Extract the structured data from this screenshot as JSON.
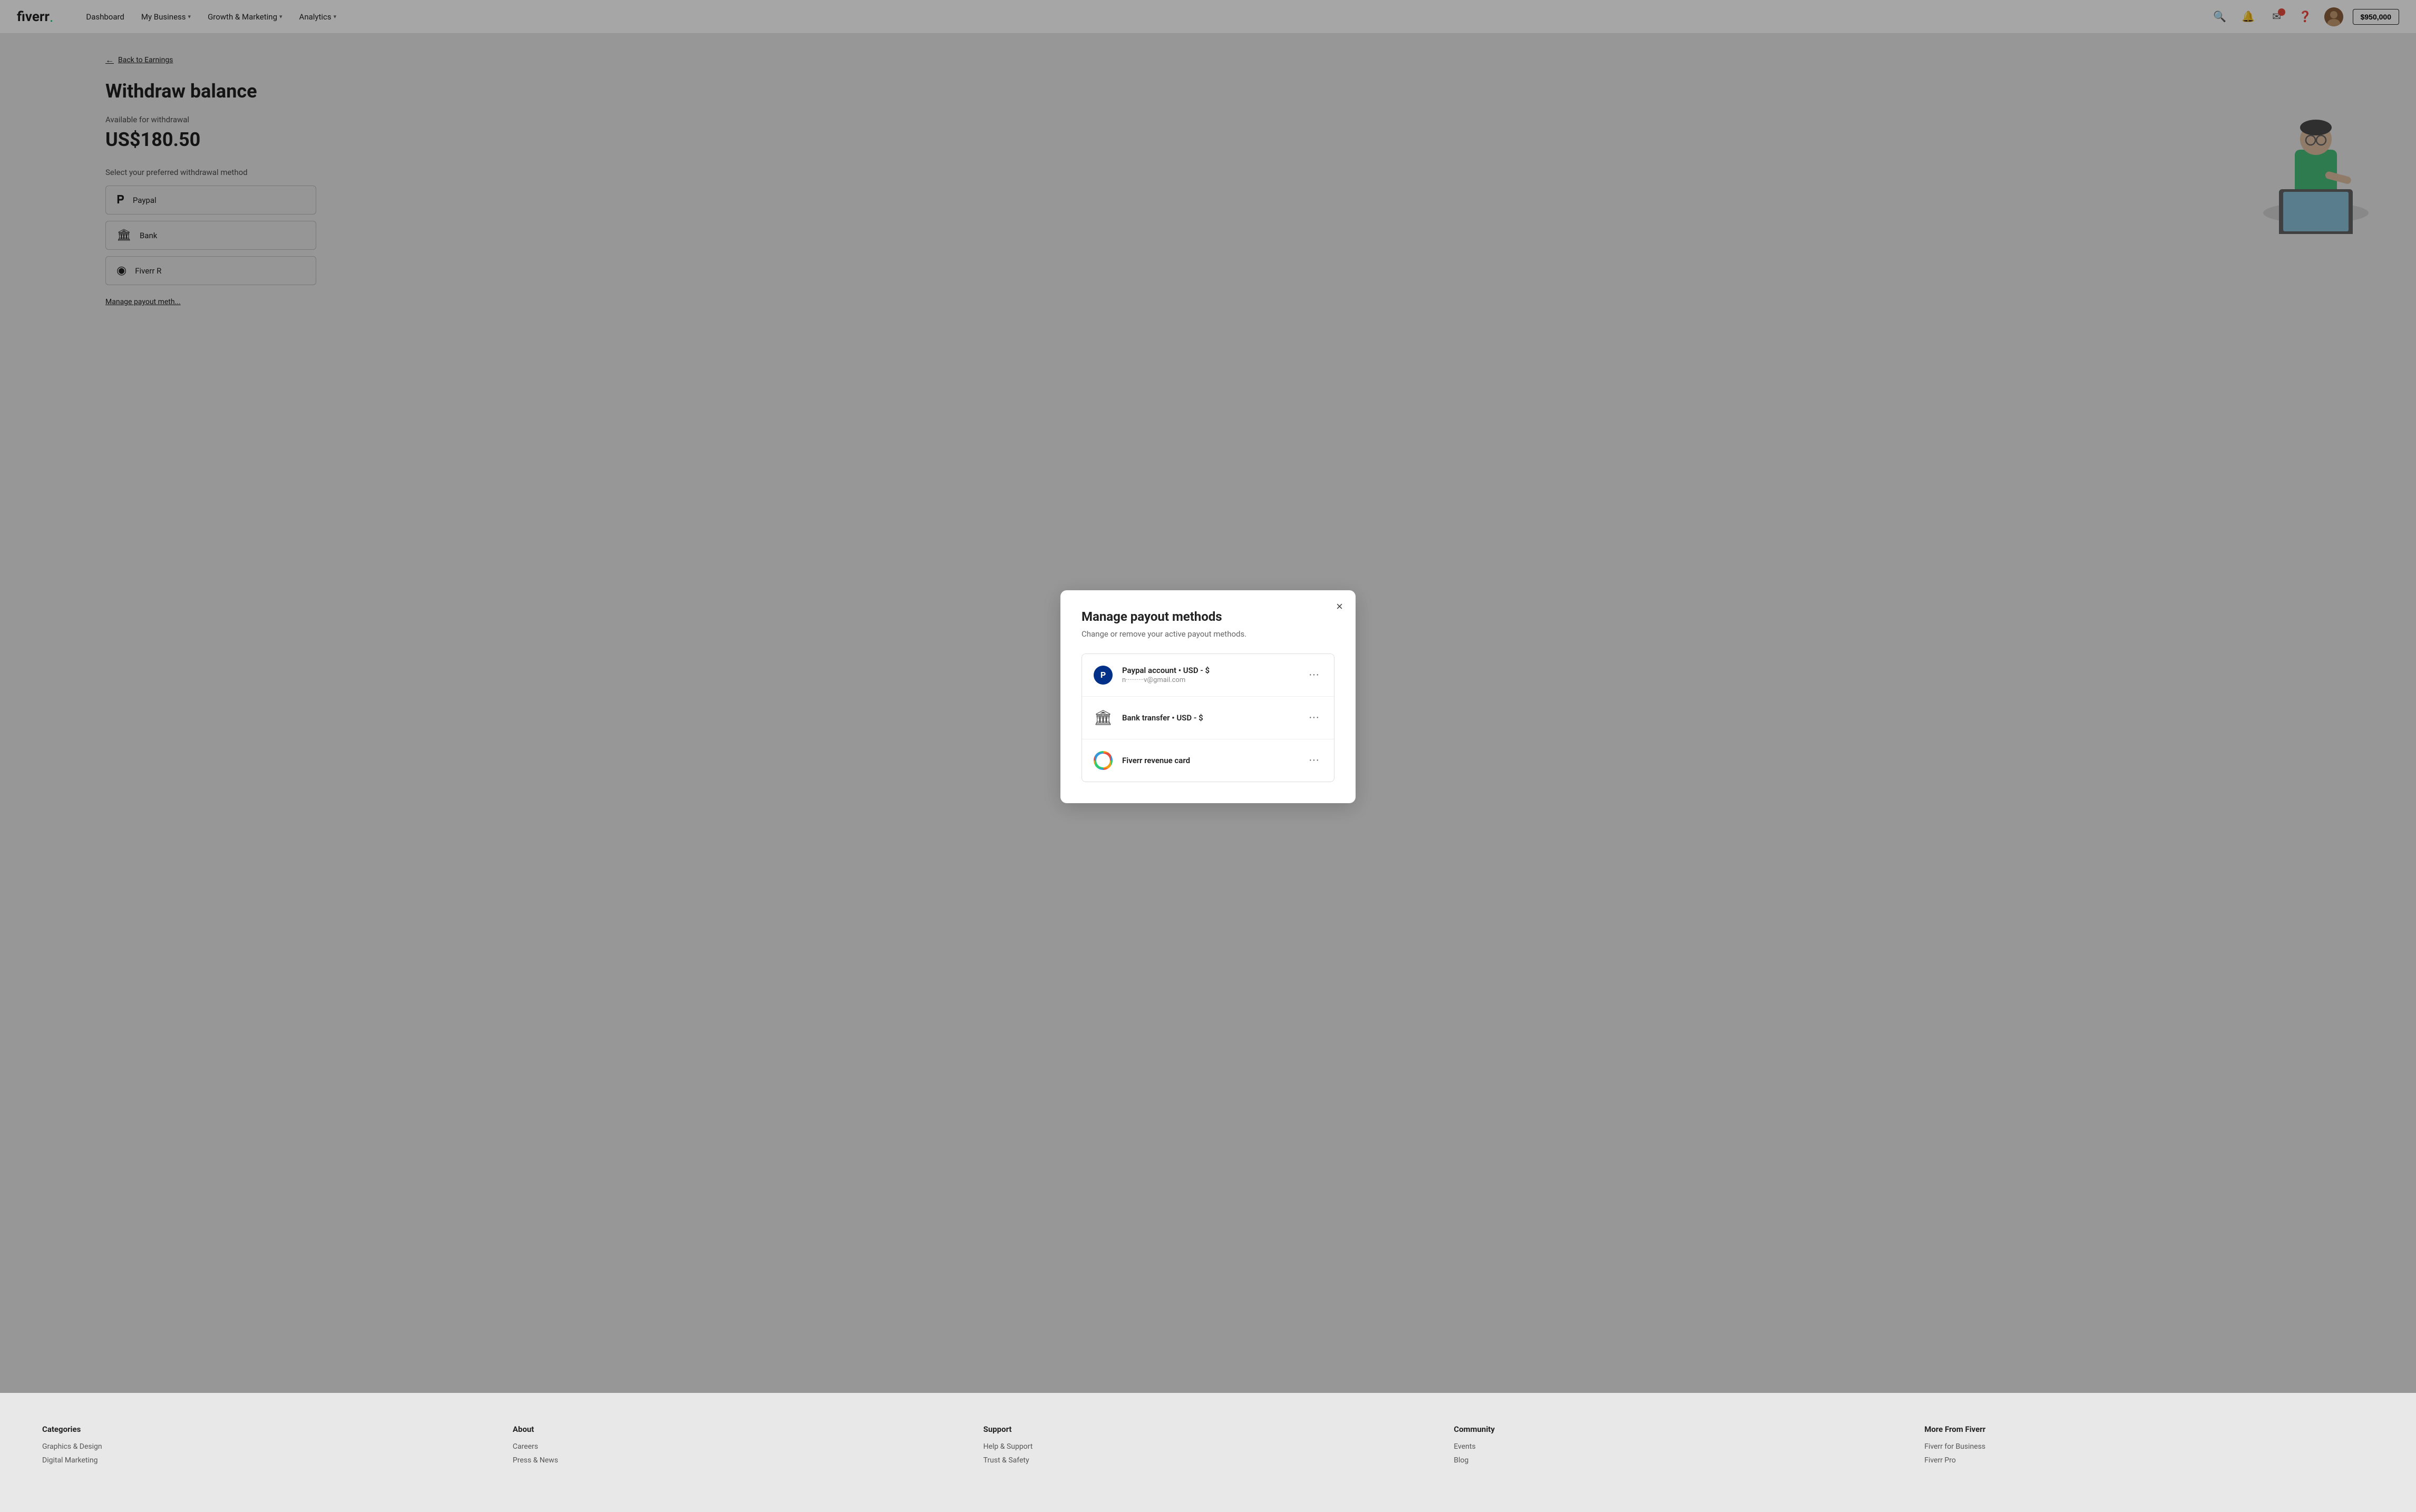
{
  "navbar": {
    "logo": "fiverr",
    "logo_dot": ".",
    "nav_items": [
      {
        "label": "Dashboard",
        "has_dropdown": false
      },
      {
        "label": "My Business",
        "has_dropdown": true
      },
      {
        "label": "Growth & Marketing",
        "has_dropdown": true
      },
      {
        "label": "Analytics",
        "has_dropdown": true
      }
    ],
    "balance": "$950,000"
  },
  "page": {
    "back_label": "Back to Earnings",
    "title": "Withdraw balance",
    "available_label": "Available for withdrawal",
    "available_amount": "US$180.50",
    "select_label": "Select your preferred withdrawal method",
    "payment_options": [
      {
        "id": "paypal",
        "label": "Paypal"
      },
      {
        "id": "bank",
        "label": "Bank"
      },
      {
        "id": "fiverr",
        "label": "Fiverr R"
      }
    ],
    "manage_link": "Manage payout meth..."
  },
  "modal": {
    "title": "Manage payout methods",
    "subtitle": "Change or remove your active payout methods.",
    "close_label": "×",
    "payout_methods": [
      {
        "id": "paypal",
        "type": "paypal",
        "name": "Paypal account • USD - $",
        "detail": "n··········v@gmail.com"
      },
      {
        "id": "bank",
        "type": "bank",
        "name": "Bank transfer • USD - $",
        "detail": ""
      },
      {
        "id": "fiverr",
        "type": "fiverr",
        "name": "Fiverr revenue card",
        "detail": ""
      }
    ],
    "menu_icon": "···"
  },
  "footer": {
    "columns": [
      {
        "title": "Categories",
        "links": [
          "Graphics & Design",
          "Digital Marketing"
        ]
      },
      {
        "title": "About",
        "links": [
          "Careers",
          "Press & News"
        ]
      },
      {
        "title": "Support",
        "links": [
          "Help & Support",
          "Trust & Safety"
        ]
      },
      {
        "title": "Community",
        "links": [
          "Events",
          "Blog"
        ]
      },
      {
        "title": "More From Fiverr",
        "links": [
          "Fiverr for Business",
          "Fiverr Pro"
        ]
      }
    ]
  }
}
